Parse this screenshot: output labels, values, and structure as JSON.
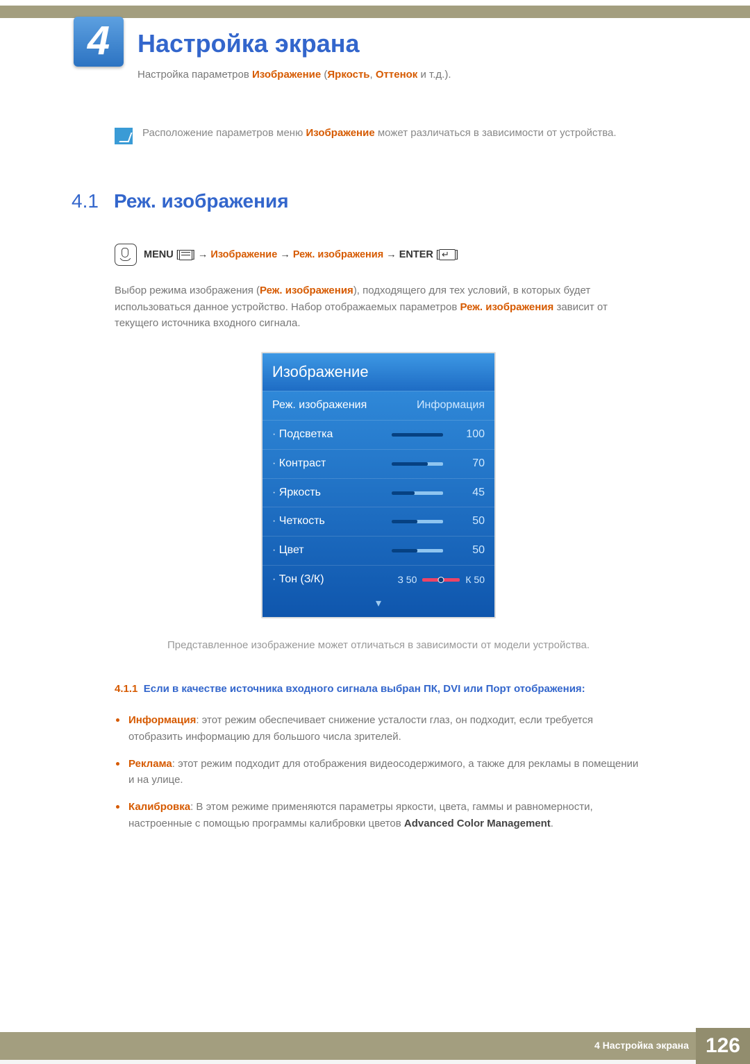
{
  "chapter": {
    "number": "4",
    "title": "Настройка экрана",
    "subtitle_pre": "Настройка параметров ",
    "subtitle_h1": "Изображение",
    "subtitle_mid": " (",
    "subtitle_h2": "Яркость",
    "subtitle_sep": ", ",
    "subtitle_h3": "Оттенок",
    "subtitle_post": " и т.д.)."
  },
  "note": {
    "pre": "Расположение параметров меню ",
    "word": "Изображение",
    "post": " может различаться в зависимости от устройства."
  },
  "section": {
    "num": "4.1",
    "title": "Реж. изображения"
  },
  "navpath": {
    "menu": "MENU",
    "b1": "[",
    "b2": "]",
    "arrow": " → ",
    "step1": "Изображение",
    "step2": "Реж. изображения",
    "enter": "ENTER"
  },
  "paragraph": {
    "p1a": "Выбор режима изображения (",
    "p1b": "Реж. изображения",
    "p1c": "), подходящего для тех условий, в которых будет использоваться данное устройство. Набор отображаемых параметров ",
    "p1d": "Реж. изображения",
    "p1e": " зависит от текущего источника входного сигнала."
  },
  "osd": {
    "title": "Изображение",
    "mode_label": "Реж. изображения",
    "mode_value": "Информация",
    "items": [
      {
        "name": "Подсветка",
        "value": "100",
        "fill": 100
      },
      {
        "name": "Контраст",
        "value": "70",
        "fill": 70
      },
      {
        "name": "Яркость",
        "value": "45",
        "fill": 45
      },
      {
        "name": "Четкость",
        "value": "50",
        "fill": 50
      },
      {
        "name": "Цвет",
        "value": "50",
        "fill": 50
      }
    ],
    "tint": {
      "name": "Тон (З/К)",
      "left": "З 50",
      "right": "К 50"
    },
    "arrow_down": "▾"
  },
  "caption": "Представленное изображение может отличаться в зависимости от модели устройства.",
  "subsection": {
    "num": "4.1.1",
    "title": "Если в качестве источника входного сигнала выбран ПК, DVI или Порт отображения:"
  },
  "bullets": {
    "b1_name": "Информация",
    "b1_text": ": этот режим обеспечивает снижение усталости глаз, он подходит, если требуется отобразить информацию для большого числа зрителей.",
    "b2_name": "Реклама",
    "b2_text": ": этот режим подходит для отображения видеосодержимого, а также для рекламы в помещении и на улице.",
    "b3_name": "Калибровка",
    "b3_text_a": ": В этом режиме применяются параметры яркости, цвета, гаммы и равномерности, настроенные с помощью программы калибровки цветов ",
    "b3_bold": "Advanced Color Management",
    "b3_text_b": "."
  },
  "footer": {
    "crumb": "4 Настройка экрана",
    "page": "126"
  }
}
